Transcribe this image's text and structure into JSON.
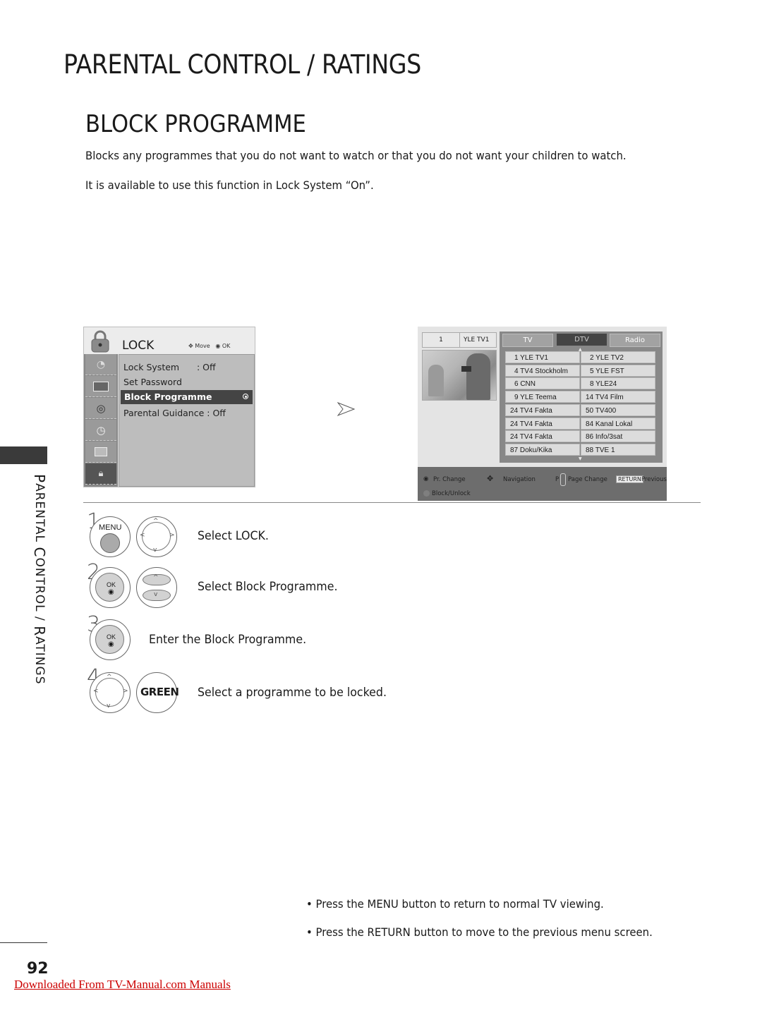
{
  "header": {
    "section_title": "PARENTAL CONTROL / RATINGS",
    "page_title": "BLOCK PROGRAMME"
  },
  "intro": {
    "line1": "Blocks any programmes that you do not want to watch or that you do not want your children to watch.",
    "line2": "It is available to use this function in Lock System “On”."
  },
  "side_tab": {
    "label_first": "P",
    "label_rest": "ARENTAL ",
    "label_c": "C",
    "label_rest2": "ONTROL / ",
    "label_r": "R",
    "label_rest3": "ATINGS"
  },
  "lock_menu": {
    "title": "LOCK",
    "hint_move": "Move",
    "hint_ok": "OK",
    "items": [
      {
        "label": "Lock System",
        "value": ": Off"
      },
      {
        "label": "Set Password",
        "value": ""
      },
      {
        "label": "Block Programme",
        "value": "",
        "selected": true
      },
      {
        "label": "Parental Guidance : Off",
        "value": ""
      }
    ],
    "side_icons": [
      "satellite-dish-icon",
      "tv-screen-icon",
      "speaker-icon",
      "clock-icon",
      "toolbox-icon",
      "lock-icon"
    ]
  },
  "programme_screen": {
    "current_number": "1",
    "current_name": "YLE TV1",
    "tabs": [
      "TV",
      "DTV",
      "Radio"
    ],
    "active_tab": "DTV",
    "channels": [
      [
        "1 YLE TV1",
        "2 YLE TV2"
      ],
      [
        "4 TV4 Stockholm",
        "5 YLE FST"
      ],
      [
        "6 CNN",
        "8 YLE24"
      ],
      [
        "9 YLE Teema",
        "14 TV4 Film"
      ],
      [
        "24 TV4 Fakta",
        "50 TV400"
      ],
      [
        "24 TV4 Fakta",
        "84 Kanal Lokal"
      ],
      [
        "24 TV4 Fakta",
        "86 Info/3sat"
      ],
      [
        "87 Doku/Kika",
        "88 TVE 1"
      ]
    ],
    "footer": {
      "pr_change": "Pr. Change",
      "navigation": "Navigation",
      "page_p": "P",
      "page_change": "Page Change",
      "return_key": "RETURN",
      "previous": "Previous",
      "block_unlock": "Block/Unlock"
    }
  },
  "steps": [
    {
      "number": "1",
      "buttons": [
        "MENU",
        "nav-ring"
      ],
      "text_pre": "Select ",
      "text_bold": "LOCK",
      "text_post": "."
    },
    {
      "number": "2",
      "buttons": [
        "OK",
        "up-down"
      ],
      "text_pre": "Select ",
      "text_bold": "Block Programme",
      "text_post": "."
    },
    {
      "number": "3",
      "buttons": [
        "OK"
      ],
      "text_pre": "Enter the ",
      "text_bold": "Block Programme",
      "text_post": "."
    },
    {
      "number": "4",
      "buttons": [
        "nav-ring",
        "GREEN"
      ],
      "text_pre": "Select a programme to be locked.",
      "text_bold": "",
      "text_post": ""
    }
  ],
  "button_labels": {
    "menu": "MENU",
    "ok": "OK",
    "green": "GREEN"
  },
  "notes": [
    {
      "pre": "• Press the ",
      "bold": "MENU",
      "post": " button to return to normal TV viewing."
    },
    {
      "pre": "• Press the ",
      "bold": "RETURN",
      "post": " button to move to the previous menu screen."
    }
  ],
  "footer": {
    "page_number": "92",
    "download_link": "Downloaded From TV-Manual.com Manuals"
  }
}
